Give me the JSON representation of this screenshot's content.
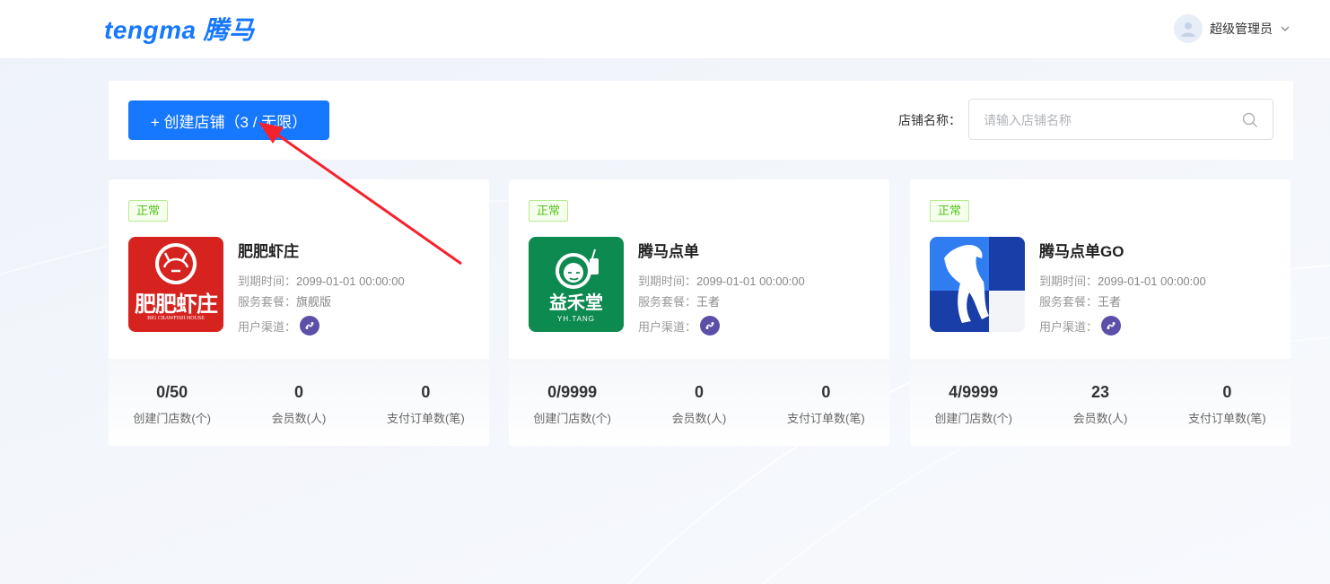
{
  "header": {
    "logo_en": "tengma",
    "logo_cn": "腾马",
    "user_name": "超级管理员"
  },
  "toolbar": {
    "create_label": "+ 创建店铺（3 / 无限）",
    "search_label": "店铺名称：",
    "search_placeholder": "请输入店铺名称",
    "search_value": ""
  },
  "labels": {
    "expire": "到期时间：",
    "package": "服务套餐：",
    "channel": "用户渠道：",
    "stores": "创建门店数(个)",
    "members": "会员数(人)",
    "orders": "支付订单数(笔)"
  },
  "stores": [
    {
      "status": "正常",
      "name": "肥肥虾庄",
      "expire": "2099-01-01 00:00:00",
      "package": "旗舰版",
      "logo_text": "肥肥虾庄",
      "logo_subtext": "BIG CRAWFISH HOUSE",
      "store_count": "0/50",
      "member_count": "0",
      "order_count": "0"
    },
    {
      "status": "正常",
      "name": "腾马点单",
      "expire": "2099-01-01 00:00:00",
      "package": "王者",
      "logo_text": "益禾堂",
      "logo_subtext": "YH.TANG",
      "store_count": "0/9999",
      "member_count": "0",
      "order_count": "0"
    },
    {
      "status": "正常",
      "name": "腾马点单GO",
      "expire": "2099-01-01 00:00:00",
      "package": "王者",
      "store_count": "4/9999",
      "member_count": "23",
      "order_count": "0"
    }
  ],
  "colors": {
    "primary": "#1677ff",
    "success": "#52c41a",
    "channel": "#5b4fa8",
    "arrow": "#f5222d"
  }
}
